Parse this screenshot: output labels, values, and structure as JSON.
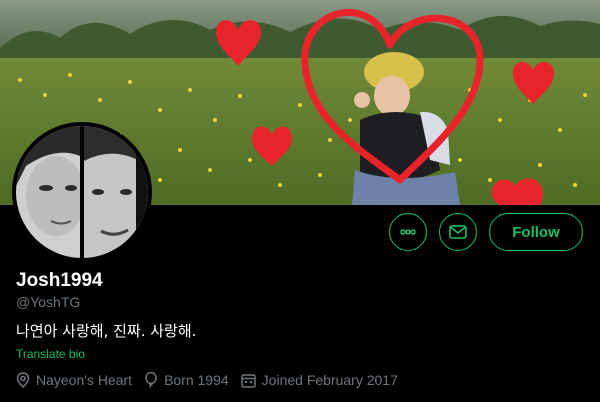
{
  "profile": {
    "display_name": "Josh1994",
    "handle": "@YoshTG",
    "bio": "나연아 사랑해, 진짜. 사랑해.",
    "translate_label": "Translate bio",
    "location": "Nayeon's Heart",
    "born": "Born 1994",
    "joined": "Joined February 2017"
  },
  "actions": {
    "more_icon": "more-icon",
    "message_icon": "envelope-icon",
    "follow_label": "Follow"
  },
  "colors": {
    "accent": "#17bf63",
    "background": "#000000",
    "secondary_text": "#6e767d",
    "heart_red": "#e8232a"
  }
}
